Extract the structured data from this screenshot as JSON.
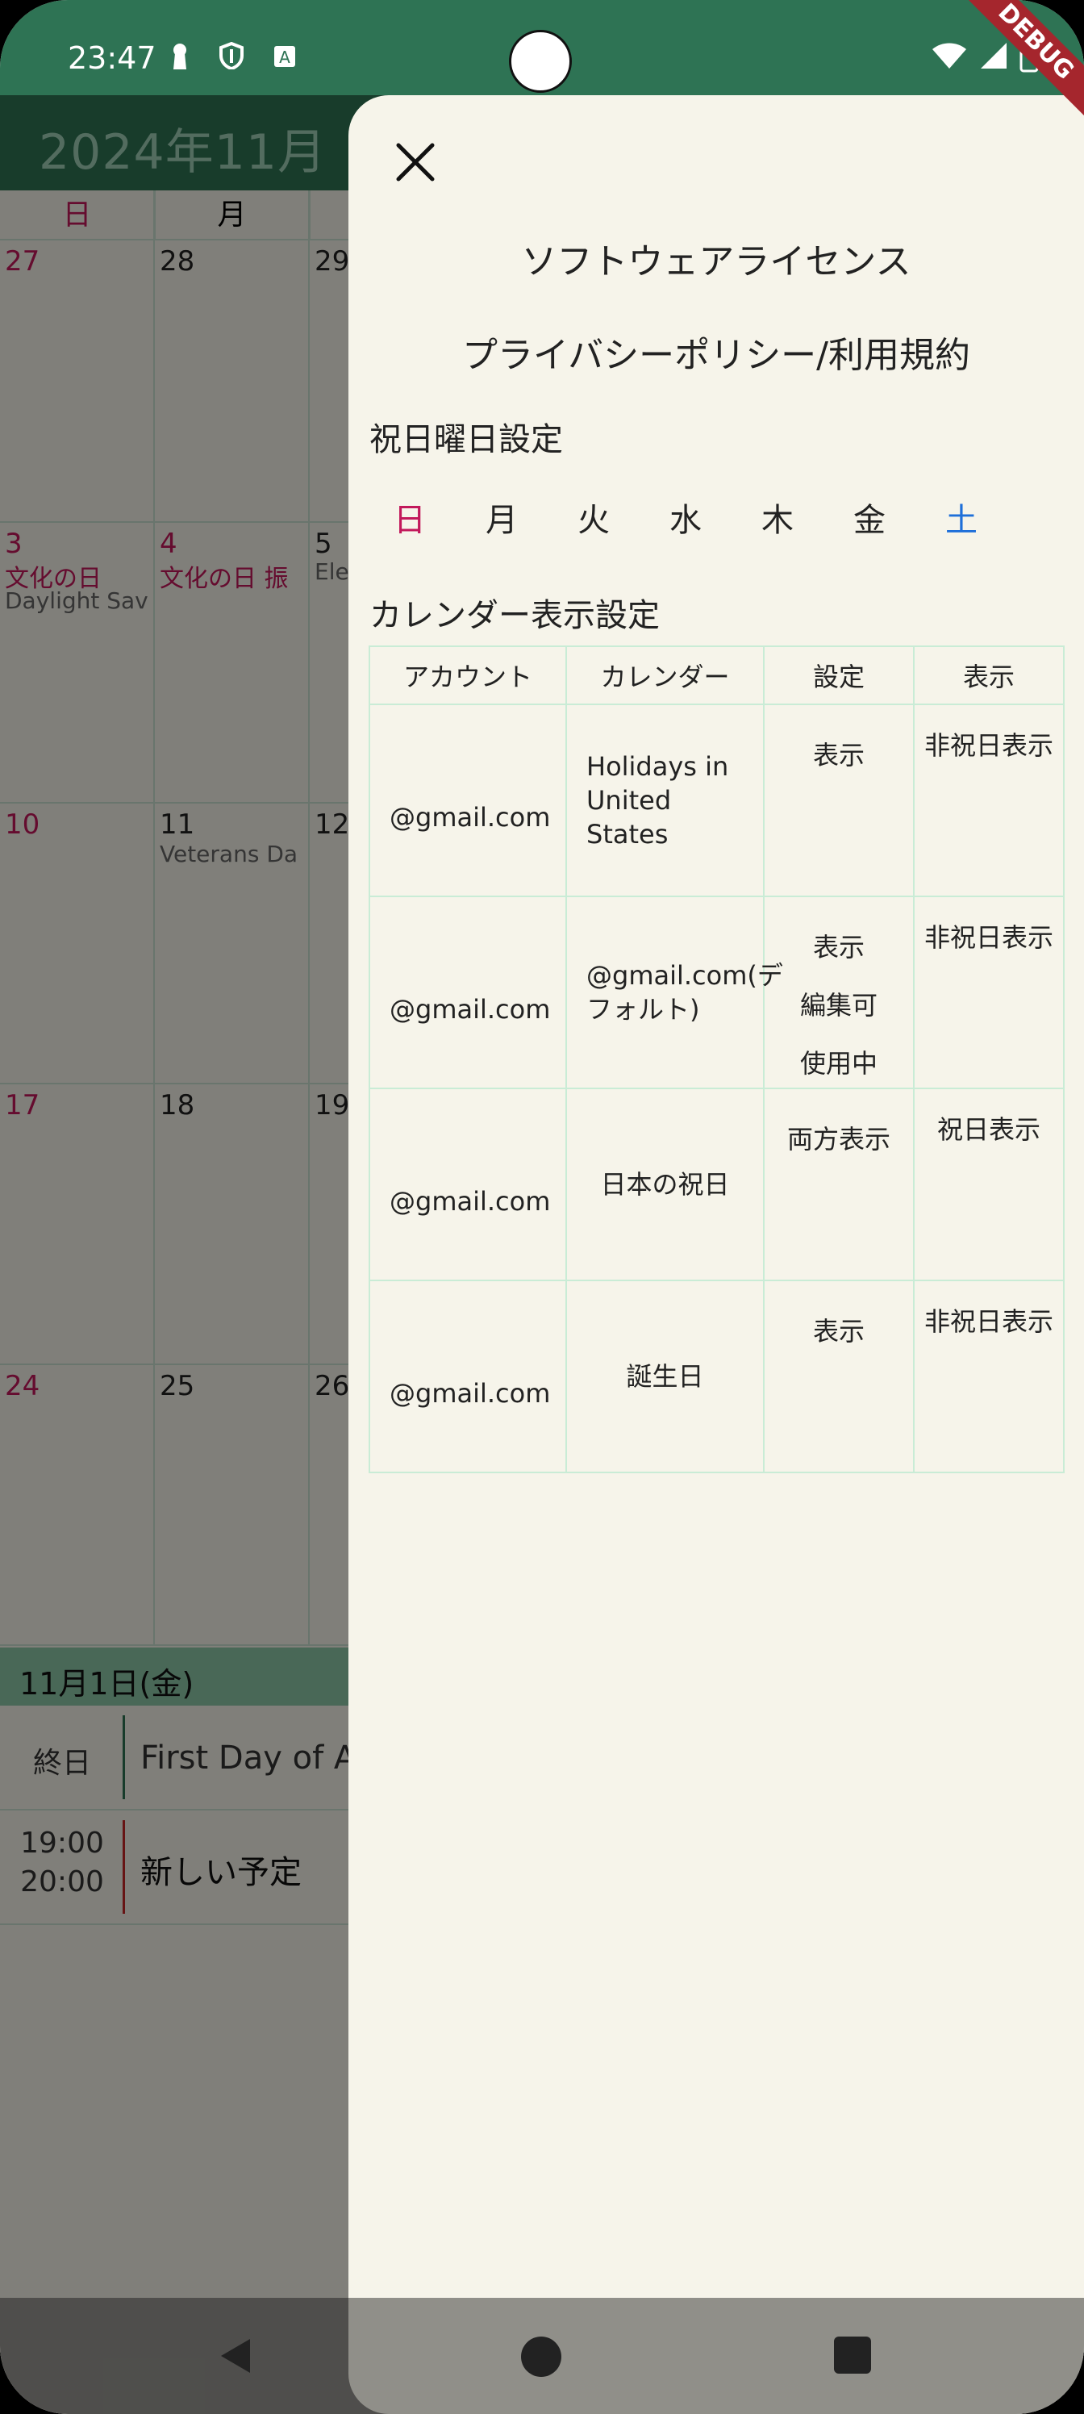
{
  "status_bar": {
    "time": "23:47"
  },
  "calendar": {
    "month_title": "2024年11月",
    "weekdays": [
      "日",
      "月"
    ],
    "weeks": [
      {
        "days": [
          {
            "num": "27",
            "events": []
          },
          {
            "num": "28",
            "events": []
          },
          {
            "num": "29",
            "events": []
          }
        ]
      },
      {
        "days": [
          {
            "num": "3",
            "events": [
              "文化の日",
              "Daylight Sav"
            ]
          },
          {
            "num": "4",
            "events": [
              "文化の日 振"
            ]
          },
          {
            "num": "5",
            "events": [
              "Ele"
            ]
          }
        ]
      },
      {
        "days": [
          {
            "num": "10",
            "events": []
          },
          {
            "num": "11",
            "events": [
              "Veterans Da"
            ]
          },
          {
            "num": "12",
            "events": []
          }
        ]
      },
      {
        "days": [
          {
            "num": "17",
            "events": []
          },
          {
            "num": "18",
            "events": []
          },
          {
            "num": "19",
            "events": []
          }
        ]
      },
      {
        "days": [
          {
            "num": "24",
            "events": []
          },
          {
            "num": "25",
            "events": []
          },
          {
            "num": "26",
            "events": []
          }
        ]
      }
    ],
    "selected_date": "11月1日(金)",
    "events": [
      {
        "time": "終日",
        "title": "First Day of Ar"
      },
      {
        "time_start": "19:00",
        "time_end": "20:00",
        "title": "新しい予定"
      }
    ]
  },
  "drawer": {
    "menu": [
      "ソフトウェアライセンス",
      "プライバシーポリシー/利用規約"
    ],
    "holiday_section_title": "祝日曜日設定",
    "days_of_week": [
      "日",
      "月",
      "火",
      "水",
      "木",
      "金",
      "土"
    ],
    "display_section_title": "カレンダー表示設定",
    "table_headers": [
      "アカウント",
      "カレンダー",
      "設定",
      "表示"
    ],
    "rows": [
      {
        "account": "@gmail.com",
        "calendar": "Holidays in United States",
        "options": [
          "表示"
        ],
        "display": "非祝日表示"
      },
      {
        "account": "@gmail.com",
        "calendar": "@gmail.com(デフォルト)",
        "options": [
          "表示",
          "編集可",
          "使用中"
        ],
        "display": "非祝日表示"
      },
      {
        "account": "@gmail.com",
        "calendar": "日本の祝日",
        "options": [
          "両方表示"
        ],
        "display": "祝日表示"
      },
      {
        "account": "@gmail.com",
        "calendar": "誕生日",
        "options": [
          "表示"
        ],
        "display": "非祝日表示"
      }
    ]
  },
  "debug_banner": "DEBUG",
  "colors": {
    "primary": "#2e7354",
    "sunday": "#c2185b",
    "saturday": "#1e6fd9",
    "background": "#f6f4ea"
  }
}
